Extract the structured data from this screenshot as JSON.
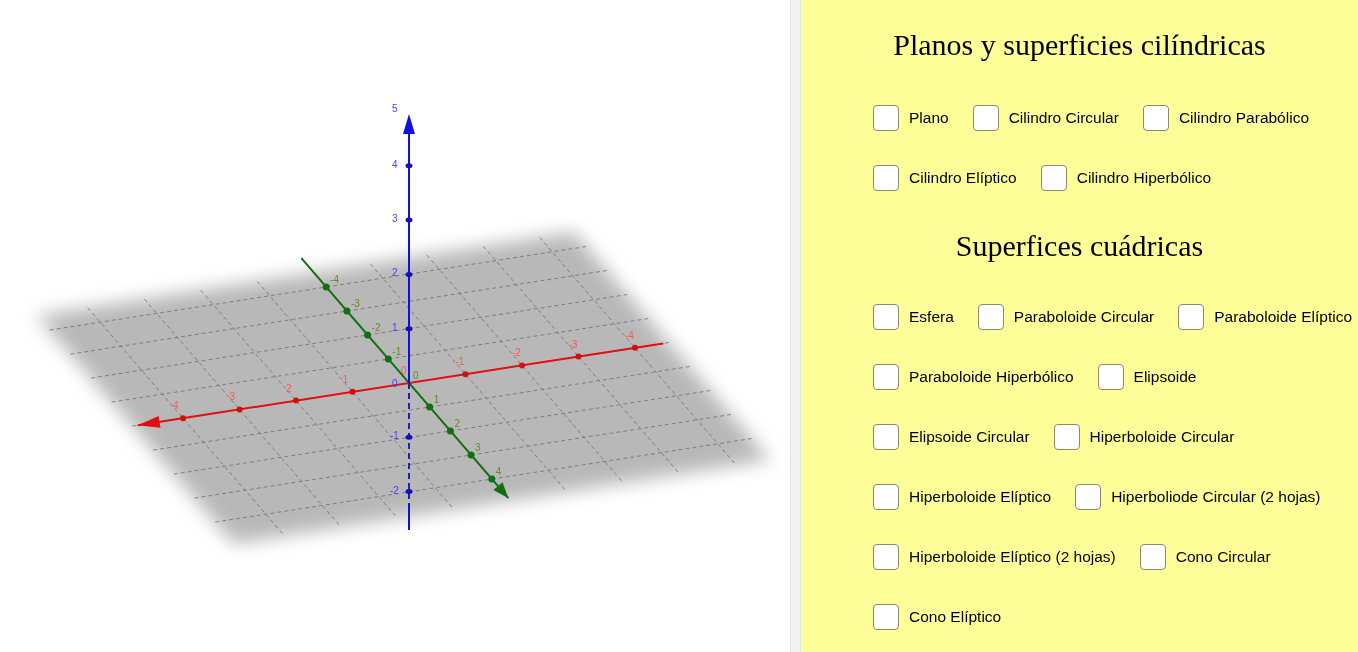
{
  "graph": {
    "x_axis": {
      "labels": [
        "4",
        "3",
        "2",
        "1",
        "0",
        "-1",
        "-2",
        "-3",
        "-4"
      ]
    },
    "y_axis": {
      "labels": [
        "-4",
        "-3",
        "-2",
        "-1",
        "0",
        "1",
        "2",
        "3",
        "4"
      ]
    },
    "z_axis": {
      "labels": [
        "5",
        "4",
        "3",
        "2",
        "1",
        "0",
        "-1",
        "-2"
      ]
    }
  },
  "panel": {
    "sections": [
      {
        "title": "Planos y superficies cilíndricas",
        "rows": [
          [
            {
              "label": "Plano",
              "checked": false
            },
            {
              "label": "Cilindro Circular",
              "checked": false
            },
            {
              "label": "Cilindro Parabólico",
              "checked": false
            }
          ],
          [
            {
              "label": "Cilindro Elíptico",
              "checked": false
            },
            {
              "label": "Cilindro Hiperbólico",
              "checked": false
            }
          ]
        ]
      },
      {
        "title": "Superfices cuádricas",
        "rows": [
          [
            {
              "label": "Esfera",
              "checked": false
            },
            {
              "label": "Paraboloide Circular",
              "checked": false
            },
            {
              "label": "Paraboloide Elíptico",
              "checked": false
            }
          ],
          [
            {
              "label": "Paraboloide Hiperbólico",
              "checked": false
            },
            {
              "label": "Elipsoide",
              "checked": false
            }
          ],
          [
            {
              "label": "Elipsoide Circular",
              "checked": false
            },
            {
              "label": "Hiperboloide Circular",
              "checked": false
            }
          ],
          [
            {
              "label": "Hiperboloide Elíptico",
              "checked": false
            },
            {
              "label": "Hiperboliode Circular (2 hojas)",
              "checked": false
            }
          ],
          [
            {
              "label": "Hiperboloide Elíptico (2 hojas)",
              "checked": false
            },
            {
              "label": "Cono Circular",
              "checked": false
            }
          ],
          [
            {
              "label": "Cono Elíptico",
              "checked": false
            }
          ]
        ]
      }
    ]
  }
}
